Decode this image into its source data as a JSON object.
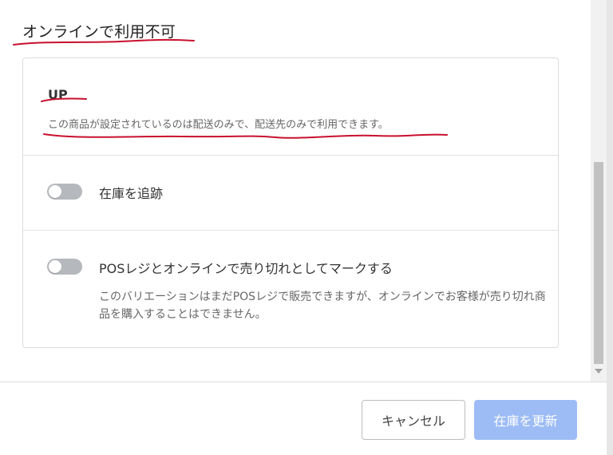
{
  "section": {
    "title": "オンラインで利用不可"
  },
  "up_block": {
    "title": "UP",
    "description": "この商品が設定されているのは配送のみで、配送先のみで利用できます。"
  },
  "track_inventory": {
    "label": "在庫を追跡",
    "enabled": false
  },
  "sold_out_online": {
    "label": "POSレジとオンラインで売り切れとしてマークする",
    "help": "このバリエーションはまだPOSレジで販売できますが、オンラインでお客様が売り切れ商品を購入することはできません。",
    "enabled": false
  },
  "footer": {
    "cancel_label": "キャンセル",
    "update_label": "在庫を更新"
  },
  "colors": {
    "primary_button": "#9dbcf6",
    "toggle_off": "#b5b8bd",
    "annotation_red": "#c8102e",
    "border": "#dcdcdc"
  },
  "icons": {
    "scroll_down": "triangle-down-icon"
  }
}
